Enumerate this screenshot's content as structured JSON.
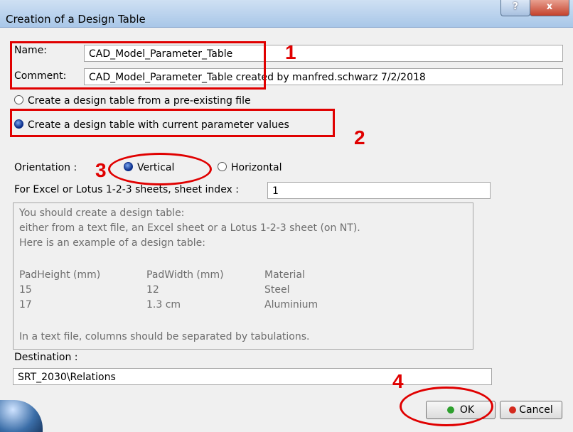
{
  "window": {
    "title": "Creation of a Design Table",
    "help_glyph": "?",
    "close_glyph": "x"
  },
  "form": {
    "name_label": "Name:",
    "name_value": "CAD_Model_Parameter_Table",
    "comment_label": "Comment:",
    "comment_value": "CAD_Model_Parameter_Table created by manfred.schwarz 7/2/2018",
    "option_preexisting": "Create a design table from a pre-existing file",
    "option_current": "Create a design table with current parameter values",
    "orientation_label": "Orientation :",
    "orientation_vertical": "Vertical",
    "orientation_horizontal": "Horizontal",
    "sheet_index_label": "For Excel or Lotus 1-2-3 sheets, sheet index :",
    "sheet_index_value": "1",
    "destination_label": "Destination :",
    "destination_value": "SRT_2030\\Relations"
  },
  "info": {
    "line1": "You should create a design table:",
    "line2": "either from a text file, an Excel sheet or a Lotus 1-2-3 sheet (on NT).",
    "line3": "Here is an example of a design table:",
    "headers": [
      "PadHeight (mm)",
      "PadWidth (mm)",
      "Material"
    ],
    "rows": [
      [
        "15",
        "12",
        "Steel"
      ],
      [
        "17",
        "1.3 cm",
        "Aluminium"
      ]
    ],
    "footer": "In a text file, columns should be separated by tabulations."
  },
  "buttons": {
    "ok": "OK",
    "cancel": "Cancel"
  },
  "annotations": {
    "n1": "1",
    "n2": "2",
    "n3": "3",
    "n4": "4"
  },
  "colors": {
    "annotation": "#e00000",
    "ok_dot": "#2ea02e",
    "cancel_dot": "#d42a1e"
  }
}
